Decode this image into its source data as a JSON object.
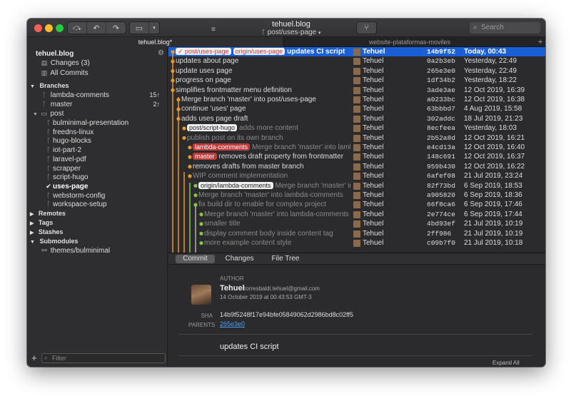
{
  "window": {
    "title": "tehuel.blog",
    "branch": "post/uses-page"
  },
  "search": {
    "placeholder": "Search"
  },
  "tabs": [
    "tehuel.blog*",
    "website-plataformas-moviles"
  ],
  "sidebar": {
    "repo": "tehuel.blog",
    "changes": "Changes (3)",
    "all_commits": "All Commits",
    "branches_header": "Branches",
    "branches": [
      {
        "name": "lambda-comments",
        "count": "15↑"
      },
      {
        "name": "master",
        "count": "2↑"
      }
    ],
    "post_folder": "post",
    "post_branches": [
      "bulminimal-presentation",
      "freedns-linux",
      "hugo-blocks",
      "iot-part-2",
      "laravel-pdf",
      "scrapper",
      "script-hugo",
      "uses-page",
      "webstorm-config",
      "workspace-setup"
    ],
    "remotes_header": "Remotes",
    "tags_header": "Tags",
    "stashes_header": "Stashes",
    "submodules_header": "Submodules",
    "submodule": "themes/bulminimal",
    "filter_placeholder": "Filter"
  },
  "commits": [
    {
      "tags": [
        {
          "t": "✓ post/uses-page",
          "c": "white"
        },
        {
          "t": "origin/uses-page",
          "c": "white"
        }
      ],
      "msg": "updates CI script",
      "author": "Tehuel",
      "sha": "14b9f52",
      "date": "Today, 00:43",
      "selected": true
    },
    {
      "tags": [],
      "msg": "updates about page",
      "author": "Tehuel",
      "sha": "0a2b3eb",
      "date": "Yesterday, 22:49"
    },
    {
      "tags": [],
      "msg": "update uses page",
      "author": "Tehuel",
      "sha": "265e3e0",
      "date": "Yesterday, 22:49"
    },
    {
      "tags": [],
      "msg": "progress on page",
      "author": "Tehuel",
      "sha": "1df34b2",
      "date": "Yesterday, 18:22"
    },
    {
      "tags": [],
      "msg": "simplifies frontmatter menu definition",
      "author": "Tehuel",
      "sha": "3ade3ae",
      "date": "12 Oct 2019, 16:39"
    },
    {
      "tags": [],
      "msg": "Merge branch 'master' into post/uses-page",
      "author": "Tehuel",
      "sha": "a0233bc",
      "date": "12 Oct 2019, 16:38"
    },
    {
      "tags": [],
      "msg": "continue 'uses' page",
      "author": "Tehuel",
      "sha": "63bbbd7",
      "date": "4 Aug 2019, 15:58"
    },
    {
      "tags": [],
      "msg": "adds uses page draft",
      "author": "Tehuel",
      "sha": "302addc",
      "date": "18 Jul 2019, 21:23"
    },
    {
      "tags": [
        {
          "t": "post/script-hugo",
          "c": "white"
        }
      ],
      "msg": "adds more content",
      "grey": true,
      "author": "Tehuel",
      "sha": "8ecfeea",
      "date": "Yesterday, 18:03"
    },
    {
      "tags": [],
      "msg": "publish post on its own branch",
      "grey": true,
      "author": "Tehuel",
      "sha": "2b52a8d",
      "date": "12 Oct 2019, 16:21"
    },
    {
      "tags": [
        {
          "t": "lambda-comments",
          "c": "red"
        }
      ],
      "msg": "Merge branch 'master' into lambd...",
      "grey": true,
      "author": "Tehuel",
      "sha": "e4cd13a",
      "date": "12 Oct 2019, 16:40"
    },
    {
      "tags": [
        {
          "t": "master",
          "c": "red"
        }
      ],
      "msg": "removes draft property from frontmatter",
      "author": "Tehuel",
      "sha": "148c691",
      "date": "12 Oct 2019, 16:37"
    },
    {
      "tags": [],
      "msg": "removes drafts from master branch",
      "author": "Tehuel",
      "sha": "959b430",
      "date": "12 Oct 2019, 16:22"
    },
    {
      "tags": [],
      "msg": "WIP comment implementation",
      "grey": true,
      "author": "Tehuel",
      "sha": "6afef08",
      "date": "21 Jul 2019, 23:24"
    },
    {
      "tags": [
        {
          "t": "origin/lambda-comments",
          "c": "white"
        }
      ],
      "msg": "Merge branch 'master' into l...",
      "grey": true,
      "author": "Tehuel",
      "sha": "82f73bd",
      "date": "6 Sep 2019, 18:53"
    },
    {
      "tags": [],
      "msg": "Merge branch 'master' into lambda-comments",
      "grey": true,
      "author": "Tehuel",
      "sha": "a905820",
      "date": "6 Sep 2019, 18:36"
    },
    {
      "tags": [],
      "msg": "fix build dir to enable for complex project",
      "grey": true,
      "author": "Tehuel",
      "sha": "66f8ca6",
      "date": "6 Sep 2019, 17:46"
    },
    {
      "tags": [],
      "msg": "Merge branch 'master' into lambda-comments",
      "grey": true,
      "author": "Tehuel",
      "sha": "2e774ce",
      "date": "6 Sep 2019, 17:44"
    },
    {
      "tags": [],
      "msg": "smaller title",
      "grey": true,
      "author": "Tehuel",
      "sha": "4bd93ef",
      "date": "21 Jul 2019, 10:19"
    },
    {
      "tags": [],
      "msg": "display comment body inside content tag",
      "grey": true,
      "author": "Tehuel",
      "sha": "2ff986",
      "date": "21 Jul 2019, 10:19"
    },
    {
      "tags": [],
      "msg": "more example content style",
      "grey": true,
      "author": "Tehuel",
      "sha": "c09b7f0",
      "date": "21 Jul 2019, 10:18"
    }
  ],
  "detail": {
    "tabs": [
      "Commit",
      "Changes",
      "File Tree"
    ],
    "author_label": "AUTHOR",
    "author_name": "Tehuel",
    "author_email": "torresbaldi.tehuel@gmail.com",
    "author_date": "14 October 2019 at 00:43:53 GMT-3",
    "sha_label": "SHA",
    "sha": "14b9f5248f17e94bfe05849062d2986bd8c02ff5",
    "parents_label": "PARENTS",
    "parent": "265e3e0",
    "message": "updates CI script",
    "expand_all": "Expand All"
  },
  "colors": {
    "accent": "#1a5fd6",
    "graph_orange": "#e8962c",
    "graph_green": "#8bc34a"
  }
}
